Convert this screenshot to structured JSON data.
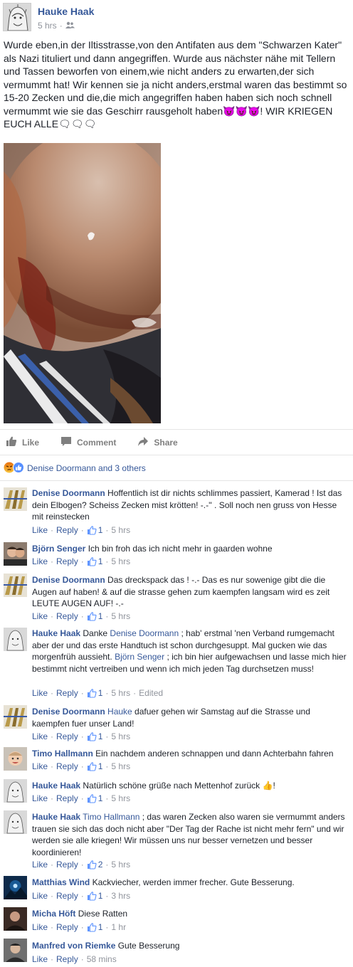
{
  "post": {
    "author": "Hauke Haak",
    "time": "5 hrs",
    "audience_icon": "friends-icon",
    "text": "Wurde eben,in der Iltisstrasse,von den Antifaten aus dem \"Schwarzen Kater\" als Nazi tituliert und dann angegriffen. Wurde aus nächster nähe mit Tellern und Tassen beworfen von einem,wie nicht anders zu erwarten,der sich vermummt hat! Wir kennen sie ja nicht anders,erstmal waren das bestimmt so 15-20 Zecken und die,die mich angegriffen haben haben sich noch schnell vermummt wie sie das Geschirr rausgeholt haben😈😈😈! WIR KRIEGEN EUCH ALLE🗨🗨🗨"
  },
  "actions": {
    "like": "Like",
    "comment": "Comment",
    "share": "Share"
  },
  "reactions": {
    "summary": "Denise Doormann and 3 others"
  },
  "comment_labels": {
    "like": "Like",
    "reply": "Reply",
    "dot": "·"
  },
  "comments": [
    {
      "name": "Denise Doormann",
      "text": "Hoffentlich ist dir nichts schlimmes passiert, Kamerad ! Ist das dein Elbogen? Scheiss Zecken mist krötten! -.-'' . Soll noch nen gruss von Hesse mit reinstecken",
      "likes": "1",
      "time": "5 hrs"
    },
    {
      "name": "Björn Senger",
      "text": "Ich bin froh das ich nicht mehr in gaarden wohne",
      "likes": "1",
      "time": "5 hrs"
    },
    {
      "name": "Denise Doormann",
      "text": "Das dreckspack das ! -.- Das es nur sowenige gibt die die Augen auf haben! & auf die strasse gehen zum kaempfen langsam wird es zeit LEUTE AUGEN AUF! -.-",
      "likes": "1",
      "time": "5 hrs"
    },
    {
      "name": "Hauke Haak",
      "pre": "Danke ",
      "mention1": "Denise Doormann",
      "mid": " ; hab' erstmal 'nen Verband rumgemacht aber der und das erste Handtuch ist schon durchgesuppt. Mal gucken wie das morgenfrüh aussieht. ",
      "mention2": "Björn Senger",
      "post": " ; ich bin hier aufgewachsen und lasse mich hier bestimmt nicht vertreiben und wenn ich mich jeden Tag durchsetzen muss!",
      "likes": "1",
      "time": "5 hrs",
      "edited": "Edited"
    },
    {
      "name": "Denise Doormann",
      "mention": "Hauke",
      "text": " dafuer gehen wir Samstag auf die Strasse und kaempfen fuer unser Land!",
      "likes": "1",
      "time": "5 hrs"
    },
    {
      "name": "Timo Hallmann",
      "text": "Ein nachdem anderen schnappen und dann Achterbahn fahren",
      "likes": "1",
      "time": "5 hrs"
    },
    {
      "name": "Hauke Haak",
      "text": "Natürlich schöne grüße nach Mettenhof zurück 👍!",
      "likes": "1",
      "time": "5 hrs"
    },
    {
      "name": "Hauke Haak",
      "mention": "Timo Hallmann",
      "text": " ; das waren Zecken also waren sie vermummt anders trauen sie sich das doch nicht aber \"Der Tag der Rache ist nicht mehr fern\" und wir werden sie alle kriegen! Wir müssen uns nur besser vernetzen und besser koordinieren!",
      "likes": "2",
      "time": "5 hrs"
    },
    {
      "name": "Matthias Wind",
      "text": "Kackviecher, werden immer frecher. Gute Besserung.",
      "likes": "1",
      "time": "3 hrs"
    },
    {
      "name": "Micha Höft",
      "text": "Diese Ratten",
      "likes": "1",
      "time": "1 hr"
    },
    {
      "name": "Manfred von Riemke",
      "text": "Gute Besserung",
      "time": "58 mins"
    }
  ],
  "colors": {
    "link": "#365899",
    "meta": "#90949c",
    "text": "#1d2129",
    "angry": "#e9710f",
    "like_blue": "#5890ff"
  }
}
